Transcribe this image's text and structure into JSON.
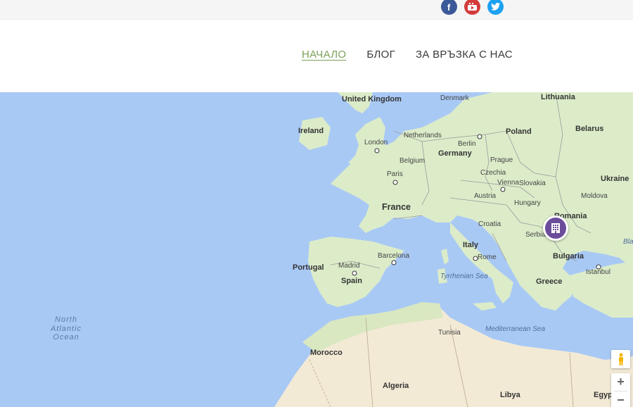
{
  "social": {
    "facebook": "facebook-icon",
    "youtube": "youtube-icon",
    "twitter": "twitter-icon"
  },
  "nav": {
    "items": [
      {
        "label": "НАЧАЛО",
        "active": true
      },
      {
        "label": "БЛОГ",
        "active": false
      },
      {
        "label": "ЗА ВРЪЗКА С НАС",
        "active": false
      }
    ]
  },
  "map": {
    "countries": [
      "United Kingdom",
      "Ireland",
      "Netherlands",
      "Belgium",
      "Germany",
      "Denmark",
      "Poland",
      "Lithuania",
      "Belarus",
      "Czechia",
      "Slovakia",
      "Austria",
      "Hungary",
      "Ukraine",
      "Moldova",
      "Romania",
      "Croatia",
      "Serbia",
      "Bulgaria",
      "France",
      "Italy",
      "Portugal",
      "Spain",
      "Greece",
      "Tunisia",
      "Morocco",
      "Algeria",
      "Libya",
      "Egypt"
    ],
    "cities": [
      "London",
      "Paris",
      "Berlin",
      "Prague",
      "Vienna",
      "Madrid",
      "Barcelona",
      "Rome",
      "Istanbul"
    ],
    "seas": [
      "Tyrrhenian Sea",
      "Mediterranean Sea",
      "Bla"
    ],
    "ocean": "North Atlantic Ocean",
    "marker_icon": "building-icon",
    "pegman_icon": "pegman-icon",
    "zoom_in": "+",
    "zoom_out": "−"
  },
  "colors": {
    "water": "#a9c9f5",
    "land": "#dcecc9",
    "desert": "#f3ead6",
    "marker": "#6b4c9a",
    "nav_active": "#7aa05a"
  }
}
